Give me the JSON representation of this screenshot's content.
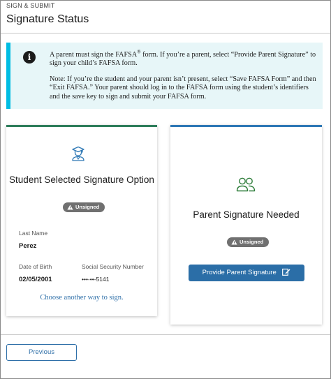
{
  "header": {
    "kicker": "SIGN & SUBMIT",
    "title": "Signature Status"
  },
  "alert": {
    "icon": "info-icon",
    "para1_pre": "A parent must sign the FAFSA",
    "para1_sup": "®",
    "para1_post": " form. If you’re a parent, select “Provide Parent Signature” to sign your child’s FAFSA form.",
    "para2": "Note: If you’re the student and your parent isn’t present, select “Save FAFSA Form” and then “Exit FAFSA.” Your parent should log in to the FAFSA form using the student’s identifiers and the save key to sign and submit your FAFSA form."
  },
  "student_card": {
    "icon": "student-graduate-icon",
    "title": "Student Selected Signature Option",
    "badge": "Unsigned",
    "last_name_label": "Last Name",
    "last_name_value": "Perez",
    "dob_label": "Date of Birth",
    "dob_value": "02/05/2001",
    "ssn_label": "Social Security Number",
    "ssn_value": "•••-••-5141",
    "link_label": "Choose another way to sign."
  },
  "parent_card": {
    "icon": "parents-icon",
    "title": "Parent Signature Needed",
    "badge": "Unsigned",
    "button_label": "Provide Parent Signature"
  },
  "footer": {
    "previous_label": "Previous"
  },
  "colors": {
    "alert_bg": "#e7f6f8",
    "alert_border": "#00bde3",
    "student_accent": "#2e7d5b",
    "parent_accent": "#2e78b5",
    "primary_button": "#2b6ea7",
    "link": "#2e6fa8",
    "badge_bg": "#707070"
  }
}
